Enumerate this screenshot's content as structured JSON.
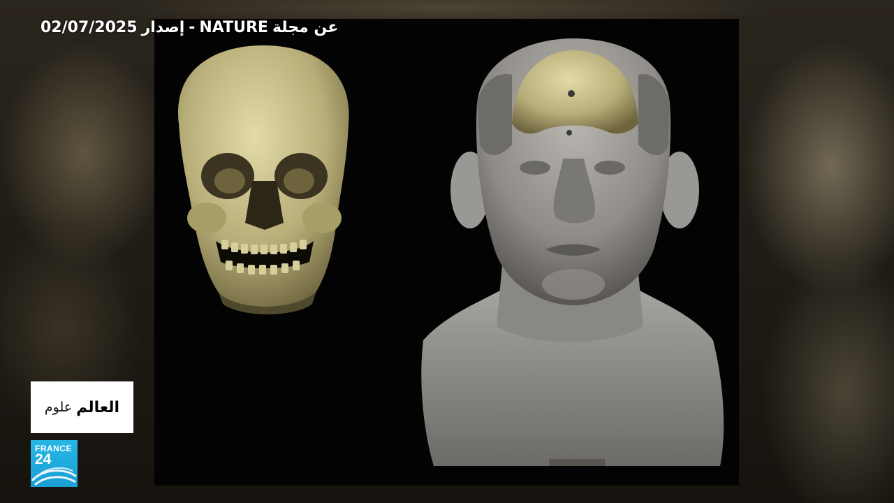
{
  "overlay": {
    "headline_source": "عن مجلة",
    "headline_brand": "NATURE",
    "headline_sep": "-",
    "headline_issue": "إصدار",
    "headline_date": "02/07/2025"
  },
  "program": {
    "title_bold": "العالم",
    "title_light": "علوم"
  },
  "channel_logo": {
    "line1": "FRANCE",
    "line2": "24",
    "color": "#1fa8dc"
  },
  "image": {
    "left_subject": "skull-3d-render",
    "right_subject": "facial-reconstruction-bust-3d-render",
    "skull_color": "#c9c08e",
    "bust_color": "#8c8a86"
  }
}
